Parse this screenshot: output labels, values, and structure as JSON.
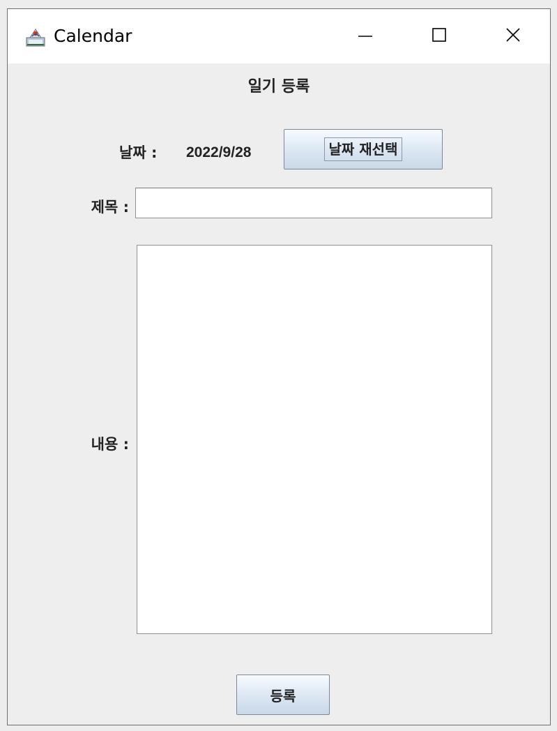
{
  "window": {
    "title": "Calendar",
    "icon": "java-app-icon",
    "controls": {
      "minimize": "minimize-icon",
      "maximize": "maximize-icon",
      "close": "close-icon"
    }
  },
  "form": {
    "heading": "일기 등록",
    "date_label": "날짜 :",
    "date_value": "2022/9/28",
    "reselect_button": "날짜 재선택",
    "title_label": "제목 :",
    "title_value": "",
    "content_label": "내용 :",
    "content_value": "",
    "submit_button": "등록"
  }
}
